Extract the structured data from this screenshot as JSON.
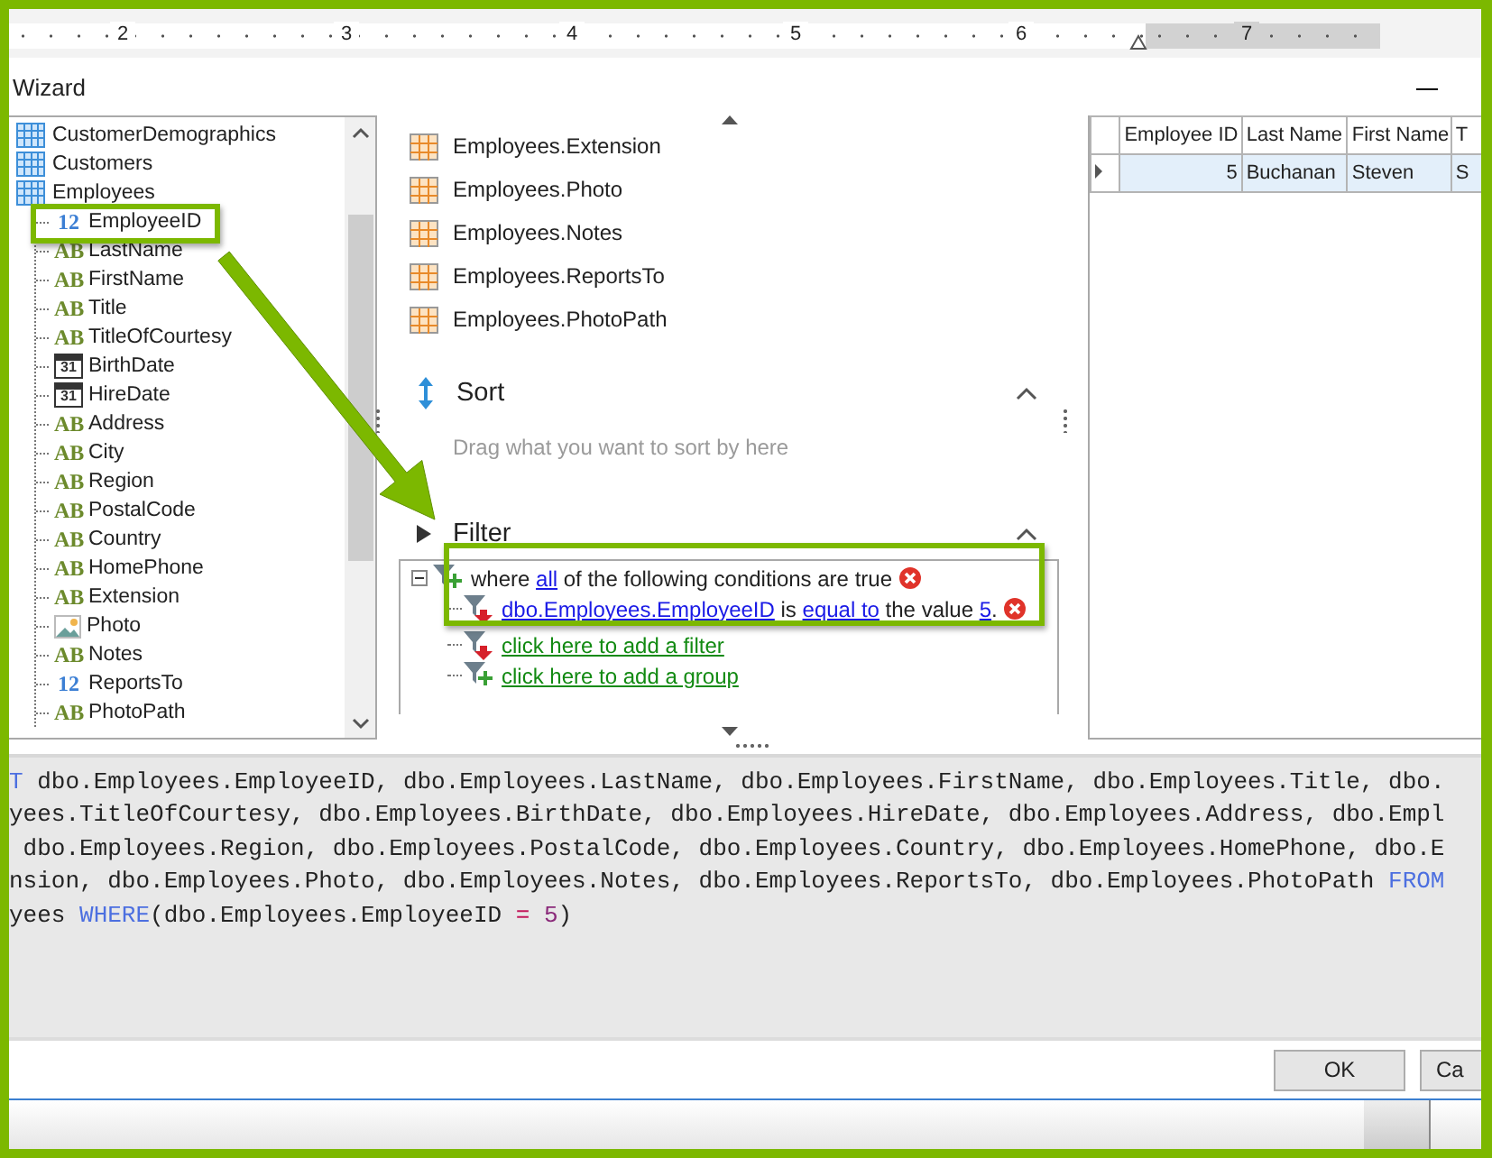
{
  "ruler": {
    "numbers": [
      "2",
      "3",
      "4",
      "5",
      "6",
      "7"
    ]
  },
  "window": {
    "title": "Wizard"
  },
  "tree": {
    "items": [
      {
        "label": "CustomerDemographics",
        "kind": "table"
      },
      {
        "label": "Customers",
        "kind": "table"
      },
      {
        "label": "Employees",
        "kind": "table",
        "children": [
          {
            "label": "EmployeeID",
            "kind": "number",
            "badge": "12"
          },
          {
            "label": "LastName",
            "kind": "text",
            "badge": "AB"
          },
          {
            "label": "FirstName",
            "kind": "text",
            "badge": "AB"
          },
          {
            "label": "Title",
            "kind": "text",
            "badge": "AB"
          },
          {
            "label": "TitleOfCourtesy",
            "kind": "text",
            "badge": "AB"
          },
          {
            "label": "BirthDate",
            "kind": "date",
            "badge": "31"
          },
          {
            "label": "HireDate",
            "kind": "date",
            "badge": "31"
          },
          {
            "label": "Address",
            "kind": "text",
            "badge": "AB"
          },
          {
            "label": "City",
            "kind": "text",
            "badge": "AB"
          },
          {
            "label": "Region",
            "kind": "text",
            "badge": "AB"
          },
          {
            "label": "PostalCode",
            "kind": "text",
            "badge": "AB"
          },
          {
            "label": "Country",
            "kind": "text",
            "badge": "AB"
          },
          {
            "label": "HomePhone",
            "kind": "text",
            "badge": "AB"
          },
          {
            "label": "Extension",
            "kind": "text",
            "badge": "AB"
          },
          {
            "label": "Photo",
            "kind": "image"
          },
          {
            "label": "Notes",
            "kind": "text",
            "badge": "AB"
          },
          {
            "label": "ReportsTo",
            "kind": "number",
            "badge": "12"
          },
          {
            "label": "PhotoPath",
            "kind": "text",
            "badge": "AB"
          }
        ]
      }
    ]
  },
  "fields": [
    "Employees.Extension",
    "Employees.Photo",
    "Employees.Notes",
    "Employees.ReportsTo",
    "Employees.PhotoPath"
  ],
  "sort": {
    "title": "Sort",
    "hint": "Drag what you want to sort by here"
  },
  "filter": {
    "title": "Filter",
    "rows": [
      {
        "kind": "group",
        "expanded": true,
        "parts": [
          {
            "text": "where ",
            "kind": "plain"
          },
          {
            "text": "all",
            "kind": "link"
          },
          {
            "text": " of the following conditions are true",
            "kind": "plain"
          }
        ]
      },
      {
        "kind": "condition",
        "parts": [
          {
            "text": "dbo.Employees.EmployeeID",
            "kind": "link"
          },
          {
            "text": " is ",
            "kind": "plain"
          },
          {
            "text": "equal to",
            "kind": "link"
          },
          {
            "text": " the value ",
            "kind": "plain"
          },
          {
            "text": "5",
            "kind": "link"
          },
          {
            "text": ".",
            "kind": "plain"
          }
        ]
      },
      {
        "kind": "add-filter",
        "parts": [
          {
            "text": "click here to add a filter",
            "kind": "action"
          }
        ]
      },
      {
        "kind": "add-group",
        "parts": [
          {
            "text": "click here to add a group",
            "kind": "action"
          }
        ]
      }
    ]
  },
  "grid": {
    "columns": [
      "Employee ID",
      "Last Name",
      "First Name",
      "T"
    ],
    "rows": [
      {
        "cells": [
          "5",
          "Buchanan",
          "Steven",
          "S"
        ],
        "selected": true
      }
    ]
  },
  "sql": {
    "lines": [
      [
        {
          "text": "T",
          "kind": "keyword"
        },
        {
          "text": " dbo.Employees.EmployeeID, dbo.Employees.LastName, dbo.Employees.FirstName, dbo.Employees.Title, dbo.",
          "kind": "plain"
        }
      ],
      [
        {
          "text": "yees.TitleOfCourtesy, dbo.Employees.BirthDate, dbo.Employees.HireDate, dbo.Employees.Address, dbo.Empl",
          "kind": "plain"
        }
      ],
      [
        {
          "text": " dbo.Employees.Region, dbo.Employees.PostalCode, dbo.Employees.Country, dbo.Employees.HomePhone, dbo.E",
          "kind": "plain"
        }
      ],
      [
        {
          "text": "nsion, dbo.Employees.Photo, dbo.Employees.Notes, dbo.Employees.ReportsTo, dbo.Employees.PhotoPath ",
          "kind": "plain"
        },
        {
          "text": "FROM",
          "kind": "keyword"
        }
      ],
      [
        {
          "text": "yees ",
          "kind": "plain"
        },
        {
          "text": "WHERE",
          "kind": "keyword"
        },
        {
          "text": "(dbo.Employees.EmployeeID ",
          "kind": "plain"
        },
        {
          "text": "= ",
          "kind": "operator"
        },
        {
          "text": "5",
          "kind": "number"
        },
        {
          "text": ")",
          "kind": "plain"
        }
      ]
    ]
  },
  "buttons": [
    "OK",
    "Ca"
  ]
}
